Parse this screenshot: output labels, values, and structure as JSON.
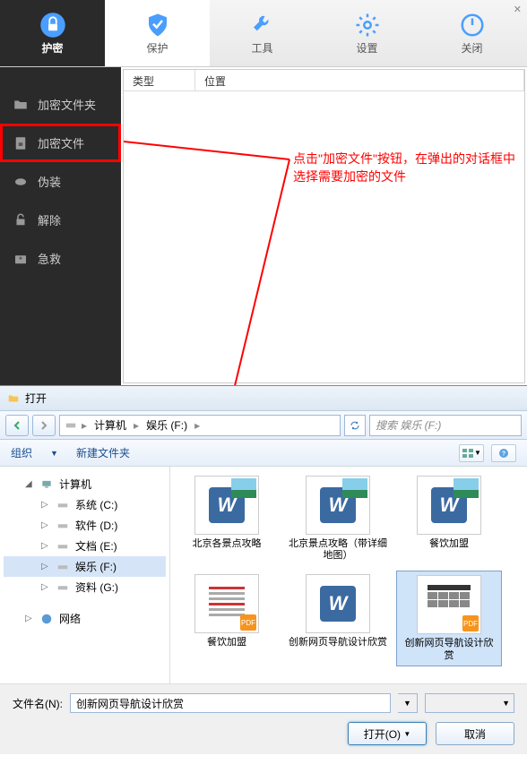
{
  "toolbar": {
    "items": [
      {
        "label": "护密"
      },
      {
        "label": "保护"
      },
      {
        "label": "工具"
      },
      {
        "label": "设置"
      },
      {
        "label": "关闭"
      }
    ]
  },
  "sidebar": {
    "items": [
      {
        "label": "加密文件夹"
      },
      {
        "label": "加密文件"
      },
      {
        "label": "伪装"
      },
      {
        "label": "解除"
      },
      {
        "label": "急救"
      }
    ]
  },
  "list": {
    "col_type": "类型",
    "col_location": "位置"
  },
  "annotation": {
    "text": "点击\"加密文件\"按钮，在弹出的对话框中选择需要加密的文件"
  },
  "dialog": {
    "title": "打开",
    "breadcrumb": [
      "计算机",
      "娱乐 (F:)"
    ],
    "search_placeholder": "搜索 娱乐 (F:)",
    "organize": "组织",
    "new_folder": "新建文件夹",
    "tree": {
      "computer": "计算机",
      "drives": [
        {
          "label": "系统 (C:)"
        },
        {
          "label": "软件 (D:)"
        },
        {
          "label": "文档 (E:)"
        },
        {
          "label": "娱乐 (F:)"
        },
        {
          "label": "资料 (G:)"
        }
      ],
      "network": "网络"
    },
    "files": [
      {
        "label": "北京各景点攻略",
        "type": "word-photo"
      },
      {
        "label": "北京景点攻略（带详细地图）",
        "type": "word-photo"
      },
      {
        "label": "餐饮加盟",
        "type": "word-photo"
      },
      {
        "label": "餐饮加盟",
        "type": "pdf-doc"
      },
      {
        "label": "创新网页导航设计欣赏",
        "type": "word"
      },
      {
        "label": "创新网页导航设计欣赏",
        "type": "web"
      }
    ],
    "filename_label": "文件名(N):",
    "filename_value": "创新网页导航设计欣赏",
    "open_btn": "打开(O)",
    "cancel_btn": "取消"
  }
}
